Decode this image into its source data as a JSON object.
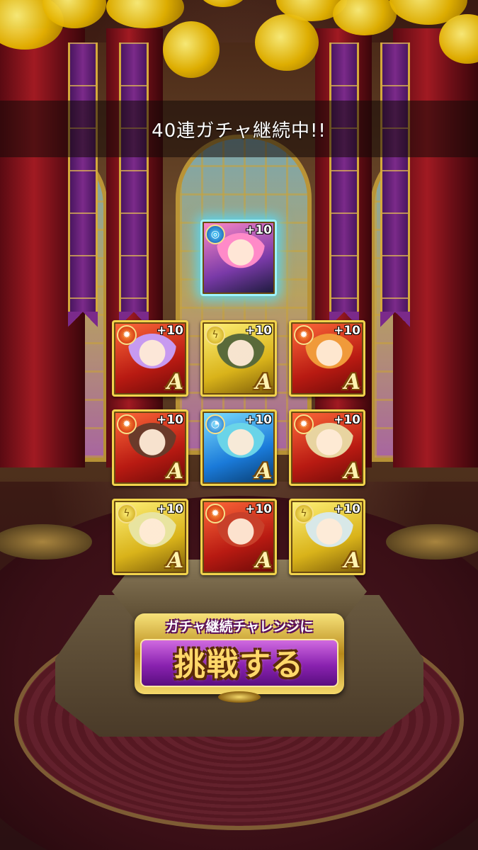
{
  "header": {
    "title": "40連ガチャ継続中!!"
  },
  "featured_card": {
    "attribute_icon": "special-ring-icon",
    "plus": "+10",
    "frame_color": "#9ef4ff"
  },
  "cards": [
    {
      "attribute": "fire",
      "icon": "flame-icon",
      "plus": "+10",
      "rank": "A",
      "hair": "#c79af0"
    },
    {
      "attribute": "light",
      "icon": "bolt-icon",
      "plus": "+10",
      "rank": "A",
      "hair": "#5a6a3a"
    },
    {
      "attribute": "fire",
      "icon": "flame-icon",
      "plus": "+10",
      "rank": "A",
      "hair": "#f09a3a"
    },
    {
      "attribute": "fire",
      "icon": "flame-icon",
      "plus": "+10",
      "rank": "A",
      "hair": "#6a3a2a"
    },
    {
      "attribute": "water",
      "icon": "water-icon",
      "plus": "+10",
      "rank": "A",
      "hair": "#6ad4e8"
    },
    {
      "attribute": "fire",
      "icon": "flame-icon",
      "plus": "+10",
      "rank": "A",
      "hair": "#e8d4a0"
    },
    {
      "attribute": "light",
      "icon": "bolt-icon",
      "plus": "+10",
      "rank": "A",
      "hair": "#e8e4a0"
    },
    {
      "attribute": "fire",
      "icon": "flame-icon",
      "plus": "+10",
      "rank": "A",
      "hair": "#c8402a"
    },
    {
      "attribute": "light",
      "icon": "bolt-icon",
      "plus": "+10",
      "rank": "A",
      "hair": "#d8e8e8"
    }
  ],
  "challenge_button": {
    "subtitle": "ガチャ継続チャレンジに",
    "label": "挑戦する"
  },
  "colors": {
    "accent_gold": "#f1d34c",
    "button_purple": "#8a22b0"
  }
}
